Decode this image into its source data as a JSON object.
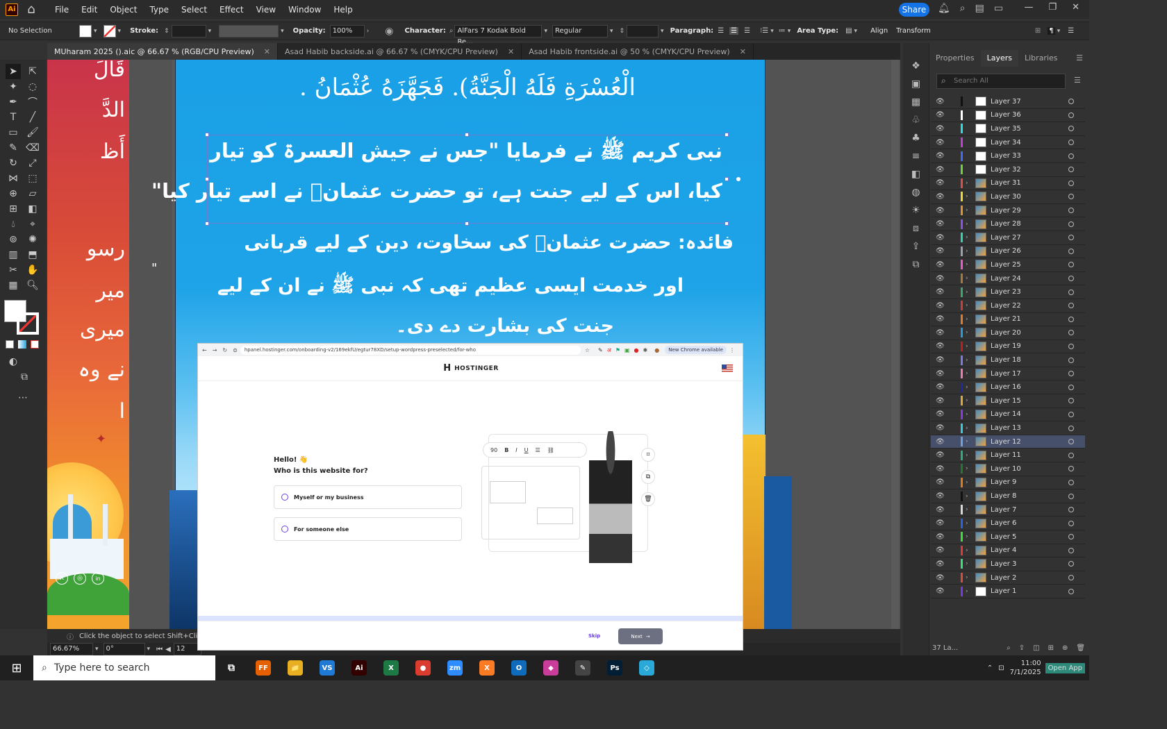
{
  "app": {
    "logo": "Ai"
  },
  "menu": [
    "File",
    "Edit",
    "Object",
    "Type",
    "Select",
    "Effect",
    "View",
    "Window",
    "Help"
  ],
  "share_label": "Share",
  "control_bar": {
    "selection": "No Selection",
    "stroke_label": "Stroke:",
    "opacity_label": "Opacity:",
    "opacity_value": "100%",
    "character_label": "Character:",
    "font_name": "AlFars 7 Kodak Bold Re...",
    "font_style": "Regular",
    "paragraph_label": "Paragraph:",
    "area_type_label": "Area Type:",
    "align_label": "Align",
    "transform_label": "Transform"
  },
  "tabs": [
    {
      "label": "MUharam 2025 ().aic @ 66.67 % (RGB/CPU Preview)"
    },
    {
      "label": "Asad Habib backside.ai @ 66.67 % (CMYK/CPU Preview)"
    },
    {
      "label": "Asad Habib frontside.ai @ 50 % (CMYK/CPU Preview)"
    }
  ],
  "artwork": {
    "arabic_top": "الْعُسْرَةِ فَلَهُ الْجَنَّةُ). فَجَهَّزَهُ عُثْمَانُ .",
    "urdu_sel_1": "نبی کریم ﷺ نے فرمایا \"جس نے جیش العسرۃ کو تیار",
    "urdu_sel_2": "کیا، اس کے لیے جنت ہے، تو حضرت عثمانؓ نے اسے تیار کیا\"",
    "urdu_3": "فائدہ: حضرت عثمانؓ کی سخاوت، دین کے لیے قربانی",
    "urdu_4": "اور خدمت ایسی عظیم تھی کہ نبی ﷺ نے ان کے لیے",
    "urdu_5": "جنت کی بشارت دے دی۔",
    "left_lines": [
      "قَالَ",
      "الدَّ",
      "أَظ",
      "رسو",
      "میر",
      "میری",
      "نے وہ",
      "ا"
    ],
    "quote_mark": "\""
  },
  "status": {
    "zoom": "66.67%",
    "rotation": "0°",
    "page": "12",
    "hint": "Click the object to select   Shift+Click to s"
  },
  "browser": {
    "url": "hpanel.hostinger.com/onboarding-v2/169ekfU/egtur78XD/setup-wordpress-preselected/for-who",
    "chrome_badge": "New Chrome available",
    "brand": "HOSTINGER",
    "hello": "Hello! 👋",
    "question": "Who is this website for?",
    "options": [
      "Myself or my business",
      "For someone else"
    ],
    "editor_size": "90",
    "skip": "Skip",
    "next": "Next"
  },
  "panel": {
    "tabs": [
      "Properties",
      "Layers",
      "Libraries"
    ],
    "search_placeholder": "Search All",
    "layers_count": "37 La...",
    "layers": [
      {
        "name": "Layer 37",
        "color": "#111111",
        "img": false,
        "chev": false
      },
      {
        "name": "Layer 36",
        "color": "#ffffff",
        "img": false,
        "chev": false
      },
      {
        "name": "Layer 35",
        "color": "#29e0e0",
        "img": false,
        "chev": false
      },
      {
        "name": "Layer 34",
        "color": "#c23fd6",
        "img": false,
        "chev": false
      },
      {
        "name": "Layer 33",
        "color": "#3f6cf0",
        "img": false,
        "chev": false
      },
      {
        "name": "Layer 32",
        "color": "#6fd43a",
        "img": false,
        "chev": false
      },
      {
        "name": "Layer 31",
        "color": "#e34b4b",
        "img": true,
        "chev": true
      },
      {
        "name": "Layer 30",
        "color": "#f0d830",
        "img": true,
        "chev": true
      },
      {
        "name": "Layer 29",
        "color": "#e0932f",
        "img": true,
        "chev": true
      },
      {
        "name": "Layer 28",
        "color": "#8b54e8",
        "img": true,
        "chev": true
      },
      {
        "name": "Layer 27",
        "color": "#30d4b0",
        "img": true,
        "chev": true
      },
      {
        "name": "Layer 26",
        "color": "#9aa3ad",
        "img": true,
        "chev": true
      },
      {
        "name": "Layer 25",
        "color": "#e85cc8",
        "img": true,
        "chev": true
      },
      {
        "name": "Layer 24",
        "color": "#a87a3a",
        "img": true,
        "chev": true
      },
      {
        "name": "Layer 23",
        "color": "#3aa86a",
        "img": true,
        "chev": true
      },
      {
        "name": "Layer 22",
        "color": "#d43a3a",
        "img": true,
        "chev": true
      },
      {
        "name": "Layer 21",
        "color": "#e07d2a",
        "img": true,
        "chev": true
      },
      {
        "name": "Layer 20",
        "color": "#2a9ae0",
        "img": true,
        "chev": true
      },
      {
        "name": "Layer 19",
        "color": "#c21c1c",
        "img": true,
        "chev": true
      },
      {
        "name": "Layer 18",
        "color": "#7a7ae8",
        "img": true,
        "chev": true
      },
      {
        "name": "Layer 17",
        "color": "#f07ab4",
        "img": true,
        "chev": true
      },
      {
        "name": "Layer 16",
        "color": "#1c2aa8",
        "img": true,
        "chev": true
      },
      {
        "name": "Layer 15",
        "color": "#e0a83a",
        "img": true,
        "chev": true
      },
      {
        "name": "Layer 14",
        "color": "#8a3ae0",
        "img": true,
        "chev": true
      },
      {
        "name": "Layer 13",
        "color": "#3ac8e0",
        "img": true,
        "chev": true
      },
      {
        "name": "Layer 12",
        "color": "#6fa0d8",
        "img": true,
        "chev": true,
        "selected": true
      },
      {
        "name": "Layer 11",
        "color": "#2ab07a",
        "img": true,
        "chev": true
      },
      {
        "name": "Layer 10",
        "color": "#1e7a2e",
        "img": true,
        "chev": true
      },
      {
        "name": "Layer 9",
        "color": "#e07a1c",
        "img": true,
        "chev": true
      },
      {
        "name": "Layer 8",
        "color": "#111111",
        "img": true,
        "chev": true
      },
      {
        "name": "Layer 7",
        "color": "#d8d8d8",
        "img": true,
        "chev": true
      },
      {
        "name": "Layer 6",
        "color": "#2a62e0",
        "img": true,
        "chev": true
      },
      {
        "name": "Layer 5",
        "color": "#3ae03a",
        "img": true,
        "chev": true
      },
      {
        "name": "Layer 4",
        "color": "#e03a3a",
        "img": true,
        "chev": true
      },
      {
        "name": "Layer 3",
        "color": "#3ae07a",
        "img": true,
        "chev": true
      },
      {
        "name": "Layer 2",
        "color": "#e0483a",
        "img": true,
        "chev": true
      },
      {
        "name": "Layer 1",
        "color": "#7a3ae0",
        "img": false,
        "chev": true
      }
    ]
  },
  "taskbar": {
    "search_placeholder": "Type here to search",
    "clock": "11:00",
    "date": "7/1/2025",
    "open_app": "Open App",
    "apps": [
      {
        "label": "FF",
        "color": "#e66000"
      },
      {
        "label": "📁",
        "color": "#e8b020"
      },
      {
        "label": "VS",
        "color": "#1e7ad4"
      },
      {
        "label": "Ai",
        "color": "#330000"
      },
      {
        "label": "X",
        "color": "#1d7a45"
      },
      {
        "label": "●",
        "color": "#db3c30"
      },
      {
        "label": "zm",
        "color": "#2d8cff"
      },
      {
        "label": "X",
        "color": "#fb7a24"
      },
      {
        "label": "O",
        "color": "#0f6cbd"
      },
      {
        "label": "◆",
        "color": "#c93c9a"
      },
      {
        "label": "✎",
        "color": "#444"
      },
      {
        "label": "Ps",
        "color": "#001e36"
      },
      {
        "label": "◇",
        "color": "#2aa8d8"
      }
    ]
  }
}
